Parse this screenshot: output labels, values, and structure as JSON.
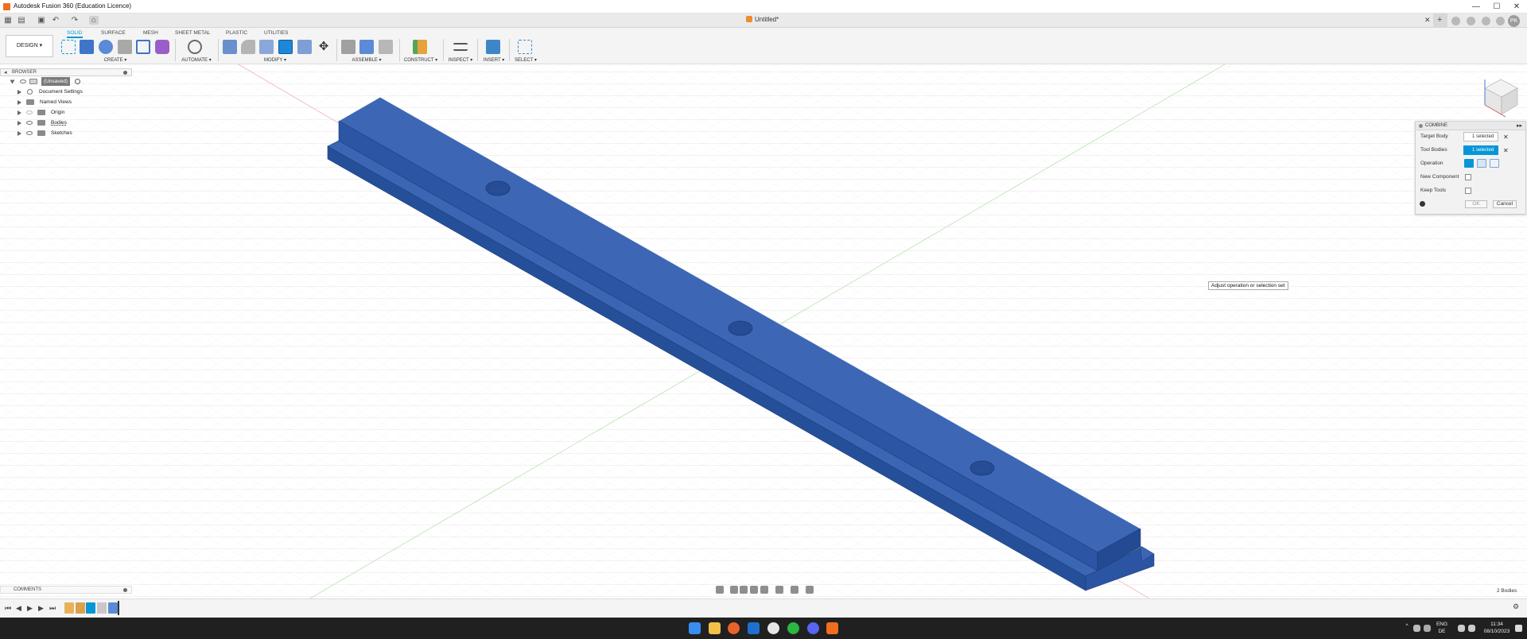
{
  "window": {
    "title": "Autodesk Fusion 360 (Education Licence)",
    "minimize": "—",
    "maximize": "☐",
    "close": "✕"
  },
  "document": {
    "tab_title": "Untitled*"
  },
  "user": {
    "initials": "PK"
  },
  "workspace": {
    "design_label": "DESIGN ▾",
    "tabs": [
      "SOLID",
      "SURFACE",
      "MESH",
      "SHEET METAL",
      "PLASTIC",
      "UTILITIES"
    ],
    "active_tab": "SOLID",
    "groups": [
      "CREATE ▾",
      "AUTOMATE ▾",
      "MODIFY ▾",
      "ASSEMBLE ▾",
      "CONSTRUCT ▾",
      "INSPECT ▾",
      "INSERT ▾",
      "SELECT ▾"
    ]
  },
  "browser": {
    "header": "BROWSER",
    "root": "(Unsaved)",
    "items": [
      "Document Settings",
      "Named Views",
      "Origin",
      "Bodies",
      "Sketches"
    ]
  },
  "comments": {
    "header": "COMMENTS"
  },
  "combine": {
    "title": "COMBINE",
    "target_body_label": "Target Body",
    "target_body_value": "1 selected",
    "tool_bodies_label": "Tool Bodies",
    "tool_bodies_value": "1 selected",
    "operation_label": "Operation",
    "new_component_label": "New Component",
    "keep_tools_label": "Keep Tools",
    "ok": "OK",
    "cancel": "Cancel"
  },
  "tooltip": "Adjust operation or selection set",
  "status": {
    "bodies_count": "2 Bodies"
  },
  "taskbar": {
    "lang_top": "ENG",
    "lang_bottom": "DE",
    "time": "11:34",
    "date": "08/10/2023"
  },
  "colors": {
    "accent": "#0696d7",
    "model_face_top": "#3d67b5",
    "model_face_side": "#2c56a4",
    "model_face_dark": "#234a93",
    "grid": "#dcdcdc"
  }
}
